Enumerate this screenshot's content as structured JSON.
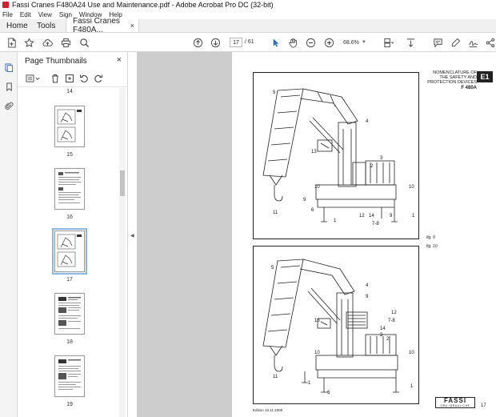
{
  "window": {
    "title": "Fassi Cranes F480A24 Use and Maintenance.pdf - Adobe Acrobat Pro DC (32-bit)"
  },
  "menu": {
    "items": [
      "File",
      "Edit",
      "View",
      "Sign",
      "Window",
      "Help"
    ]
  },
  "tabs": {
    "home": "Home",
    "tools": "Tools",
    "document": "Fassi Cranes F480A...",
    "close_glyph": "×"
  },
  "toolbar": {
    "current_page": "17",
    "total_pages": "/ 61",
    "zoom": "68.6%"
  },
  "panel": {
    "title": "Page Thumbnails",
    "close_glyph": "×",
    "thumbnails": [
      {
        "label": "14"
      },
      {
        "label": "15"
      },
      {
        "label": "16"
      },
      {
        "label": "17"
      },
      {
        "label": "18"
      },
      {
        "label": "19"
      }
    ],
    "selected_thumbnail": "17"
  },
  "document_page": {
    "header_title_lines": [
      "NOMENCLATURE OF",
      "THE SAFETY AND",
      "PROTECTION DEVICES"
    ],
    "header_model": "F 480A",
    "section_box": "E1",
    "figure_labels": [
      "fig. 9",
      "fig. 10"
    ],
    "edition": "Edition 16.11.2000",
    "logo_brand": "FASSI",
    "logo_sub": "GRU IDRAULICHE",
    "page_number": "17",
    "callouts_fig9": [
      "5",
      "4",
      "13",
      "3",
      "2",
      "10",
      "10",
      "9",
      "6",
      "11",
      "1",
      "12",
      "14",
      "7-8",
      "9",
      "1"
    ],
    "callouts_fig10": [
      "5",
      "4",
      "9",
      "13",
      "12",
      "7-8",
      "14",
      "3",
      "2",
      "10",
      "10",
      "11",
      "1",
      "6",
      "1"
    ]
  },
  "colors": {
    "accent": "#2a6ebb",
    "app_red": "#d2232a",
    "canvas_gray": "#cdcdcd"
  }
}
